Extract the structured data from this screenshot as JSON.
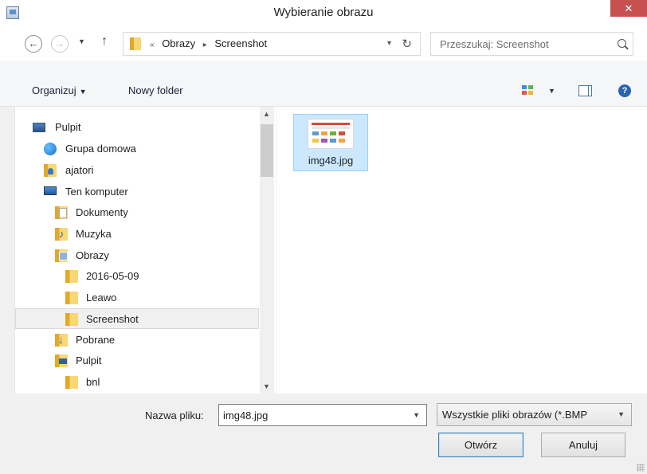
{
  "window": {
    "title": "Wybieranie obrazu",
    "close_glyph": "✕"
  },
  "address": {
    "overflow": "«",
    "crumbs": [
      "Obrazy",
      "Screenshot"
    ],
    "search_placeholder": "Przeszukaj: Screenshot"
  },
  "toolbar": {
    "organize_label": "Organizuj",
    "new_folder_label": "Nowy folder"
  },
  "nav_tree": [
    {
      "label": "Pulpit",
      "icon": "desktop-icon"
    },
    {
      "label": "Grupa domowa",
      "icon": "homegroup-icon"
    },
    {
      "label": "ajatori",
      "icon": "user-folder-icon"
    },
    {
      "label": "Ten komputer",
      "icon": "computer-icon"
    },
    {
      "label": "Dokumenty",
      "icon": "documents-folder-icon"
    },
    {
      "label": "Muzyka",
      "icon": "music-folder-icon"
    },
    {
      "label": "Obrazy",
      "icon": "pictures-folder-icon"
    },
    {
      "label": "2016-05-09",
      "icon": "folder-icon"
    },
    {
      "label": "Leawo",
      "icon": "folder-icon"
    },
    {
      "label": "Screenshot",
      "icon": "folder-icon",
      "selected": true
    },
    {
      "label": "Pobrane",
      "icon": "downloads-folder-icon"
    },
    {
      "label": "Pulpit",
      "icon": "desktop-folder-icon"
    },
    {
      "label": "bnl",
      "icon": "folder-icon"
    }
  ],
  "files": [
    {
      "name": "img48.jpg",
      "selected": true
    }
  ],
  "footer": {
    "filename_label": "Nazwa pliku:",
    "filename_value": "img48.jpg",
    "filetype_value": "Wszystkie pliki obrazów (*.BMP",
    "open_label": "Otwórz",
    "cancel_label": "Anuluj"
  },
  "colors": {
    "selection": "#cce8ff",
    "selection_border": "#99d1ff",
    "close_button": "#c75050",
    "accent": "#2864b5"
  }
}
